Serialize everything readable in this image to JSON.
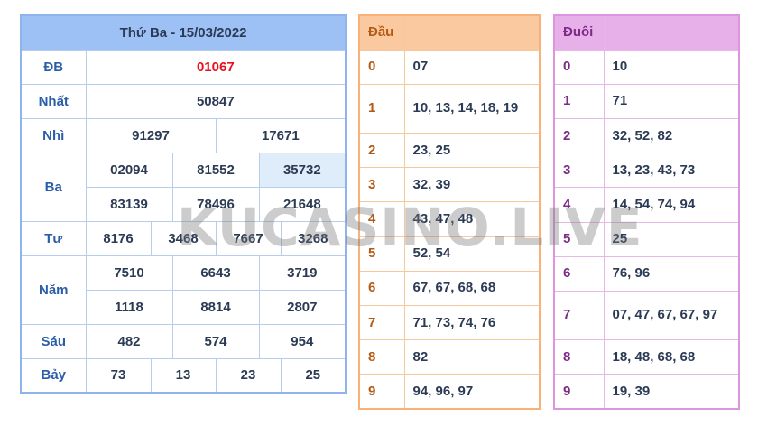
{
  "results": {
    "date_title": "Thứ Ba - 15/03/2022",
    "rows": {
      "db": {
        "label": "ĐB",
        "values": [
          "01067"
        ]
      },
      "nhat": {
        "label": "Nhất",
        "values": [
          "50847"
        ]
      },
      "nhi": {
        "label": "Nhì",
        "values": [
          "91297",
          "17671"
        ]
      },
      "ba": {
        "label": "Ba",
        "values": [
          "02094",
          "81552",
          "35732",
          "83139",
          "78496",
          "21648"
        ]
      },
      "tu": {
        "label": "Tư",
        "values": [
          "8176",
          "3468",
          "7667",
          "3268"
        ]
      },
      "nam": {
        "label": "Năm",
        "values": [
          "7510",
          "6643",
          "3719",
          "1118",
          "8814",
          "2807"
        ]
      },
      "sau": {
        "label": "Sáu",
        "values": [
          "482",
          "574",
          "954"
        ]
      },
      "bay": {
        "label": "Bảy",
        "values": [
          "73",
          "13",
          "23",
          "25"
        ]
      }
    }
  },
  "dau": {
    "header": "Đầu",
    "rows": [
      {
        "digit": "0",
        "numbers": "07"
      },
      {
        "digit": "1",
        "numbers": "10, 13, 14, 18, 19"
      },
      {
        "digit": "2",
        "numbers": "23, 25"
      },
      {
        "digit": "3",
        "numbers": "32, 39"
      },
      {
        "digit": "4",
        "numbers": "43, 47, 48"
      },
      {
        "digit": "5",
        "numbers": "52, 54"
      },
      {
        "digit": "6",
        "numbers": "67, 67, 68, 68"
      },
      {
        "digit": "7",
        "numbers": "71, 73, 74, 76"
      },
      {
        "digit": "8",
        "numbers": "82"
      },
      {
        "digit": "9",
        "numbers": "94, 96, 97"
      }
    ]
  },
  "duoi": {
    "header": "Đuôi",
    "rows": [
      {
        "digit": "0",
        "numbers": "10"
      },
      {
        "digit": "1",
        "numbers": "71"
      },
      {
        "digit": "2",
        "numbers": "32, 52, 82"
      },
      {
        "digit": "3",
        "numbers": "13, 23, 43, 73"
      },
      {
        "digit": "4",
        "numbers": "14, 54, 74, 94"
      },
      {
        "digit": "5",
        "numbers": "25"
      },
      {
        "digit": "6",
        "numbers": "76, 96"
      },
      {
        "digit": "7",
        "numbers": "07, 47, 67, 67, 97"
      },
      {
        "digit": "8",
        "numbers": "18, 48, 68, 68"
      },
      {
        "digit": "9",
        "numbers": "19, 39"
      }
    ]
  },
  "watermark": "KUCASINO.LIVE",
  "colors": {
    "results_header": "#9ec1f5",
    "special_prize": "#e8101f",
    "dau_header": "#fbc9a0",
    "duoi_header": "#e7b0e9"
  }
}
